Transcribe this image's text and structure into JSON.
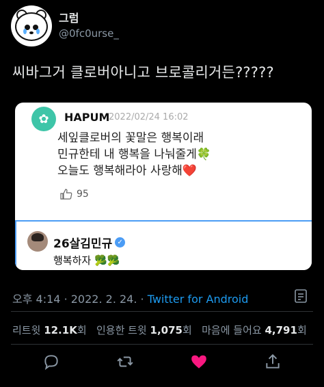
{
  "author": {
    "display_name": "그럼",
    "handle": "@0fc0urse_"
  },
  "tweet": {
    "text": "씨바그거 클로버아니고 브로콜리거든?????"
  },
  "quoted": {
    "app_name": "HAPUM",
    "date": "2022/02/24 16:02",
    "lines": [
      "세잎클로버의 꽃말은 행복이래",
      "민규한테 내 행복을 나눠줄게🍀",
      "오늘도 행복해라아 사랑해❤️"
    ],
    "likes": "95",
    "reply": {
      "name": "26살김민규",
      "text": "행복하자 🥦🥦"
    }
  },
  "meta": {
    "time": "오후 4:14",
    "date": "2022. 2. 24.",
    "separator": "·",
    "source": "Twitter for Android"
  },
  "stats": {
    "retweets_label": "리트윗",
    "retweets_value": "12.1K",
    "retweets_unit": "회",
    "quotes_label": "인용한 트윗",
    "quotes_value": "1,075",
    "quotes_unit": "회",
    "likes_label": "마음에 들어요",
    "likes_value": "4,791",
    "likes_unit": "회"
  },
  "colors": {
    "background": "#000000",
    "accent": "#1d9bf0",
    "like": "#f91880"
  }
}
